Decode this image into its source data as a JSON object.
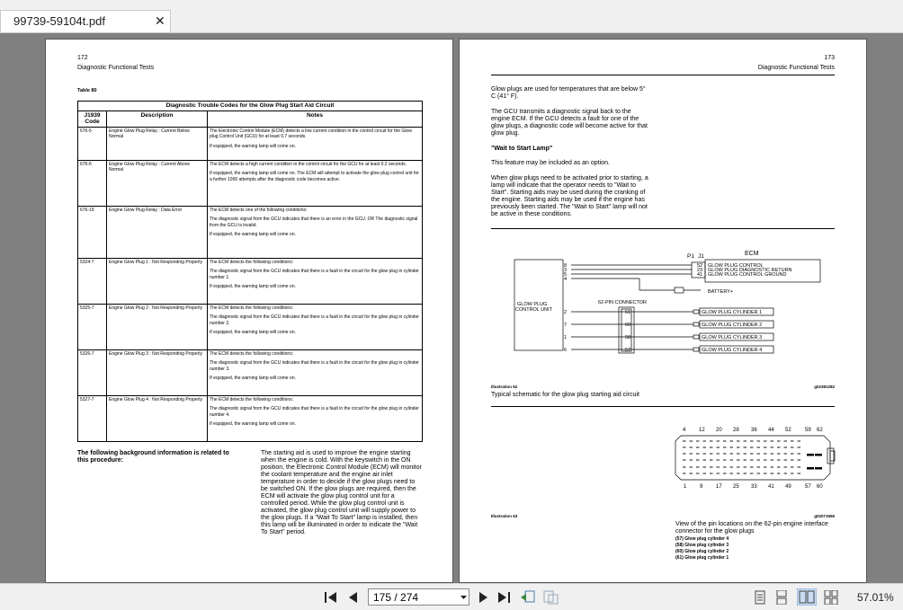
{
  "tab": {
    "title": "99739-59104t.pdf"
  },
  "page172": {
    "number": "172",
    "header": "Diagnostic Functional Tests",
    "table_label": "Table 80",
    "table_caption": "Diagnostic Trouble Codes for the Glow Plug Start Aid Circuit",
    "columns": [
      "J1939 Code",
      "Description",
      "Notes"
    ],
    "rows": [
      {
        "code": "676-5",
        "desc": "Engine Glow Plug Relay : Current Below Normal",
        "notes": [
          "The Electronic Control Module (ECM) detects a low current condition in the control circuit for the Glow plug Control Unit (GCU) for at least 0.7 seconds.",
          "If equipped, the warning lamp will come on."
        ]
      },
      {
        "code": "676-6",
        "desc": "Engine Glow Plug Relay : Current Above Normal",
        "notes": [
          "The ECM detects a high current condition in the control circuit for the GCU for at least 0.2 seconds.",
          "If equipped, the warning lamp will come on. The ECM will attempt to activate the glow plug control unit for a further 1000 attempts after the diagnostic code becomes active."
        ]
      },
      {
        "code": "676-19",
        "desc": "Engine Glow Plug Relay : Data Error",
        "notes": [
          "The ECM detects one of the following conditions:",
          "The diagnostic signal from the GCU indicates that there is an error in the GCU. OR The diagnostic signal from the GCU is invalid.",
          "If equipped, the warning lamp will come on."
        ]
      },
      {
        "code": "5324-7",
        "desc": "Engine Glow Plug 1 : Not Respondnig Properly",
        "notes": [
          "The ECM detects the following conditions:",
          "The diagnostic signal from the GCU indicates that there is a fault in the circuit for the glow plug in cylinder number 1.",
          "If equipped, the warning lamp will come on."
        ]
      },
      {
        "code": "5325-7",
        "desc": "Engine Glow Plug 2 : Not Respondnig Properly",
        "notes": [
          "The ECM detects the following conditions:",
          "The diagnostic signal from the GCU indicates that there is a fault in the circuit for the glow plug in cylinder number 2.",
          "If equipped, the warning lamp will come on."
        ]
      },
      {
        "code": "5326-7",
        "desc": "Engine Glow Plug 3 : Not Respondnig Properly",
        "notes": [
          "The ECM detects the following conditions:",
          "The diagnostic signal from the GCU indicates that there is a fault in the circuit for the glow plug in cylinder number 3.",
          "If equipped, the warning lamp will come on."
        ]
      },
      {
        "code": "5327-7",
        "desc": "Engine Glow Plug 4 : Not Respondnig Properly",
        "notes": [
          "The ECM detects the following conditions:",
          "The diagnostic signal from the GCU indicates that there is a fault in the circuit for the glow plug in cylinder number 4.",
          "If equipped, the warning lamp will come on."
        ]
      }
    ],
    "background_heading": "The following background information is related to this procedure:",
    "background_text": "The starting aid is used to improve the engine starting when the engine is cold. With the keyswitch in the ON position, the Electronic Control Module (ECM) will monitor the coolant temperature and the engine air inlet temperature in order to decide if the glow plugs need to be switched ON. If the glow plugs are required, then the ECM will activate the glow plug control unit for a controlled period. While the glow plug control unit is activated, the glow plug control unit will supply power to the glow plugs. If a \"Wait To Start\" lamp is installed, then this lamp will be illuminated in order to indicate the \"Wait To Start\" period."
  },
  "page173": {
    "number": "173",
    "header": "Diagnostic Functional Tests",
    "para1": "Glow plugs are used for temperatures that are below 5° C (41° F).",
    "para2": "The GCU transmits a diagnostic signal back to the engine ECM. If the GCU detects a fault for one of the glow plugs, a diagnostic code will become active for that glow plug.",
    "subheading": "\"Wait to Start Lamp\"",
    "para3": "This feature may be included as an option.",
    "para4": "When glow plugs need to be activated prior to starting, a lamp will indicate that the operator needs to \"Wait to Start\". Starting aids may be used during the cranking of the engine. Starting aids may be used if the engine has previously been started. The \"Wait to Start\" lamp will not be active in these conditions.",
    "schematic": {
      "ecm_label": "ECM",
      "p1": "P1",
      "j1": "J1",
      "gcu_label_1": "GLOW PLUG",
      "gcu_label_2": "CONTROL UNIT",
      "connector_label": "62-PIN CONNECTOR",
      "battery": "BATTERY+",
      "gcu_pins_top": [
        "8",
        "3",
        "5",
        "4"
      ],
      "gcu_pins_bottom": [
        "2",
        "7",
        "1",
        "6"
      ],
      "ecm_pins": [
        "52",
        "23",
        "41"
      ],
      "ecm_signals": [
        "GLOW PLUG CONTROL",
        "GLOW PLUG DIAGNOSTIC RETURN",
        "GLOW PLUG CONTROL GROUND"
      ],
      "conn_pins": [
        "61",
        "60",
        "58",
        "57"
      ],
      "cylinders": [
        "GLOW PLUG CYLINDER 1",
        "GLOW PLUG CYLINDER 2",
        "GLOW PLUG CYLINDER 3",
        "GLOW PLUG CYLINDER 4"
      ]
    },
    "illus62_label": "Illustration 62",
    "illus62_id": "g02381282",
    "illus62_caption": "Typical schematic for the glow plug starting aid circuit",
    "pins_top": [
      "4",
      "12",
      "20",
      "28",
      "36",
      "44",
      "52",
      "59",
      "62"
    ],
    "pins_bottom": [
      "1",
      "9",
      "17",
      "25",
      "33",
      "41",
      "49",
      "57",
      "60"
    ],
    "illus63_label": "Illustration 63",
    "illus63_id": "g02071556",
    "illus63_caption": "View of the pin locations on the 62-pin engine interface connector for the glow plugs",
    "pin_list": [
      "(57) Glow plug cylinder 4",
      "(58) Glow plug cylinder 3",
      "(60) Glow plug cylinder 2",
      "(61) Glow plug cylinder 1"
    ]
  },
  "toolbar": {
    "page_value": "175 / 274",
    "zoom": "57.01%"
  }
}
